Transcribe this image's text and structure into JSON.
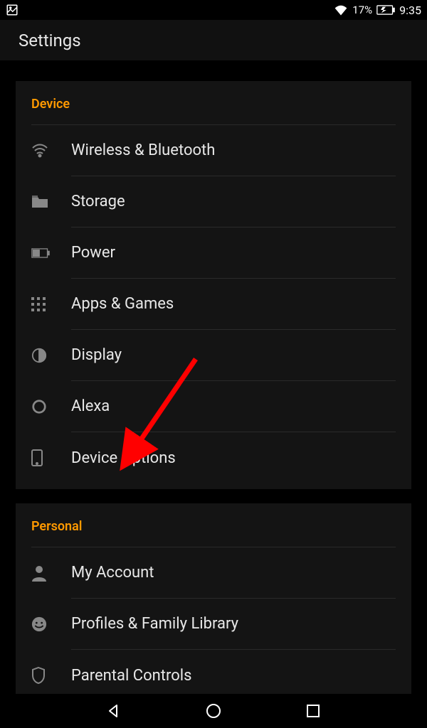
{
  "status": {
    "battery_pct": "17%",
    "time": "9:35"
  },
  "header": {
    "title": "Settings"
  },
  "sections": [
    {
      "title": "Device",
      "items": [
        {
          "icon": "wifi",
          "label": "Wireless & Bluetooth"
        },
        {
          "icon": "folder",
          "label": "Storage"
        },
        {
          "icon": "battery",
          "label": "Power"
        },
        {
          "icon": "grid",
          "label": "Apps & Games"
        },
        {
          "icon": "contrast",
          "label": "Display"
        },
        {
          "icon": "ring",
          "label": "Alexa"
        },
        {
          "icon": "phone",
          "label": "Device Options"
        }
      ]
    },
    {
      "title": "Personal",
      "items": [
        {
          "icon": "user",
          "label": "My Account"
        },
        {
          "icon": "face",
          "label": "Profiles & Family Library"
        },
        {
          "icon": "shield",
          "label": "Parental Controls"
        }
      ]
    }
  ]
}
